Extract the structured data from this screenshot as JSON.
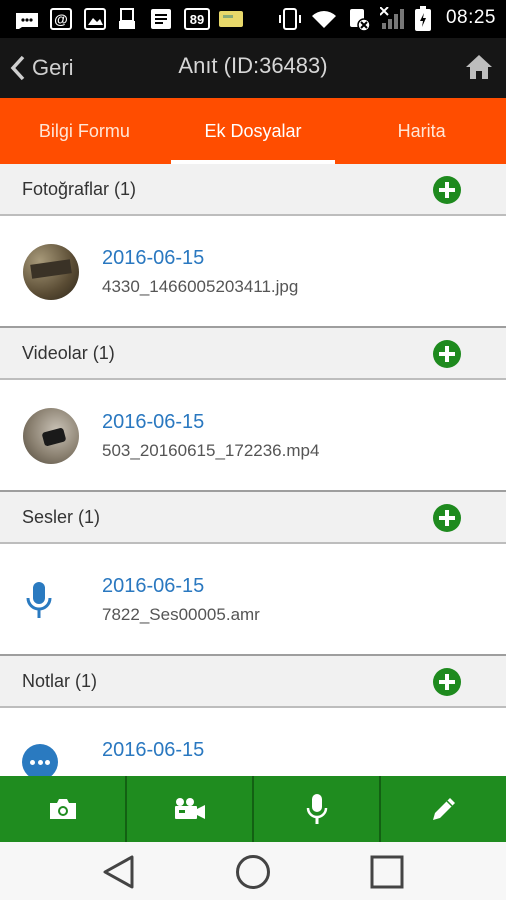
{
  "status_bar": {
    "notif_number": "89",
    "time": "08:25"
  },
  "header": {
    "back_label": "Geri",
    "title": "Anıt (ID:36483)"
  },
  "tabs": [
    {
      "label": "Bilgi Formu",
      "active": false
    },
    {
      "label": "Ek Dosyalar",
      "active": true
    },
    {
      "label": "Harita",
      "active": false
    }
  ],
  "sections": {
    "photos": {
      "title": "Fotoğraflar (1)",
      "item": {
        "date": "2016-06-15",
        "file": "4330_1466005203411.jpg"
      }
    },
    "videos": {
      "title": "Videolar (1)",
      "item": {
        "date": "2016-06-15",
        "file": "503_20160615_172236.mp4"
      }
    },
    "audio": {
      "title": "Sesler (1)",
      "item": {
        "date": "2016-06-15",
        "file": "7822_Ses00005.amr"
      }
    },
    "notes": {
      "title": "Notlar (1)",
      "item": {
        "date": "2016-06-15",
        "file": ""
      }
    }
  },
  "colors": {
    "tab_bar": "#ff4d00",
    "action_bar": "#1f8c1f",
    "date_text": "#2a78c0",
    "add_button": "#1e8a1e"
  },
  "icons": {
    "actions": [
      "camera-icon",
      "video-camera-icon",
      "microphone-icon",
      "pencil-icon"
    ],
    "navigation": [
      "back-triangle-icon",
      "home-circle-icon",
      "recents-square-icon"
    ]
  }
}
